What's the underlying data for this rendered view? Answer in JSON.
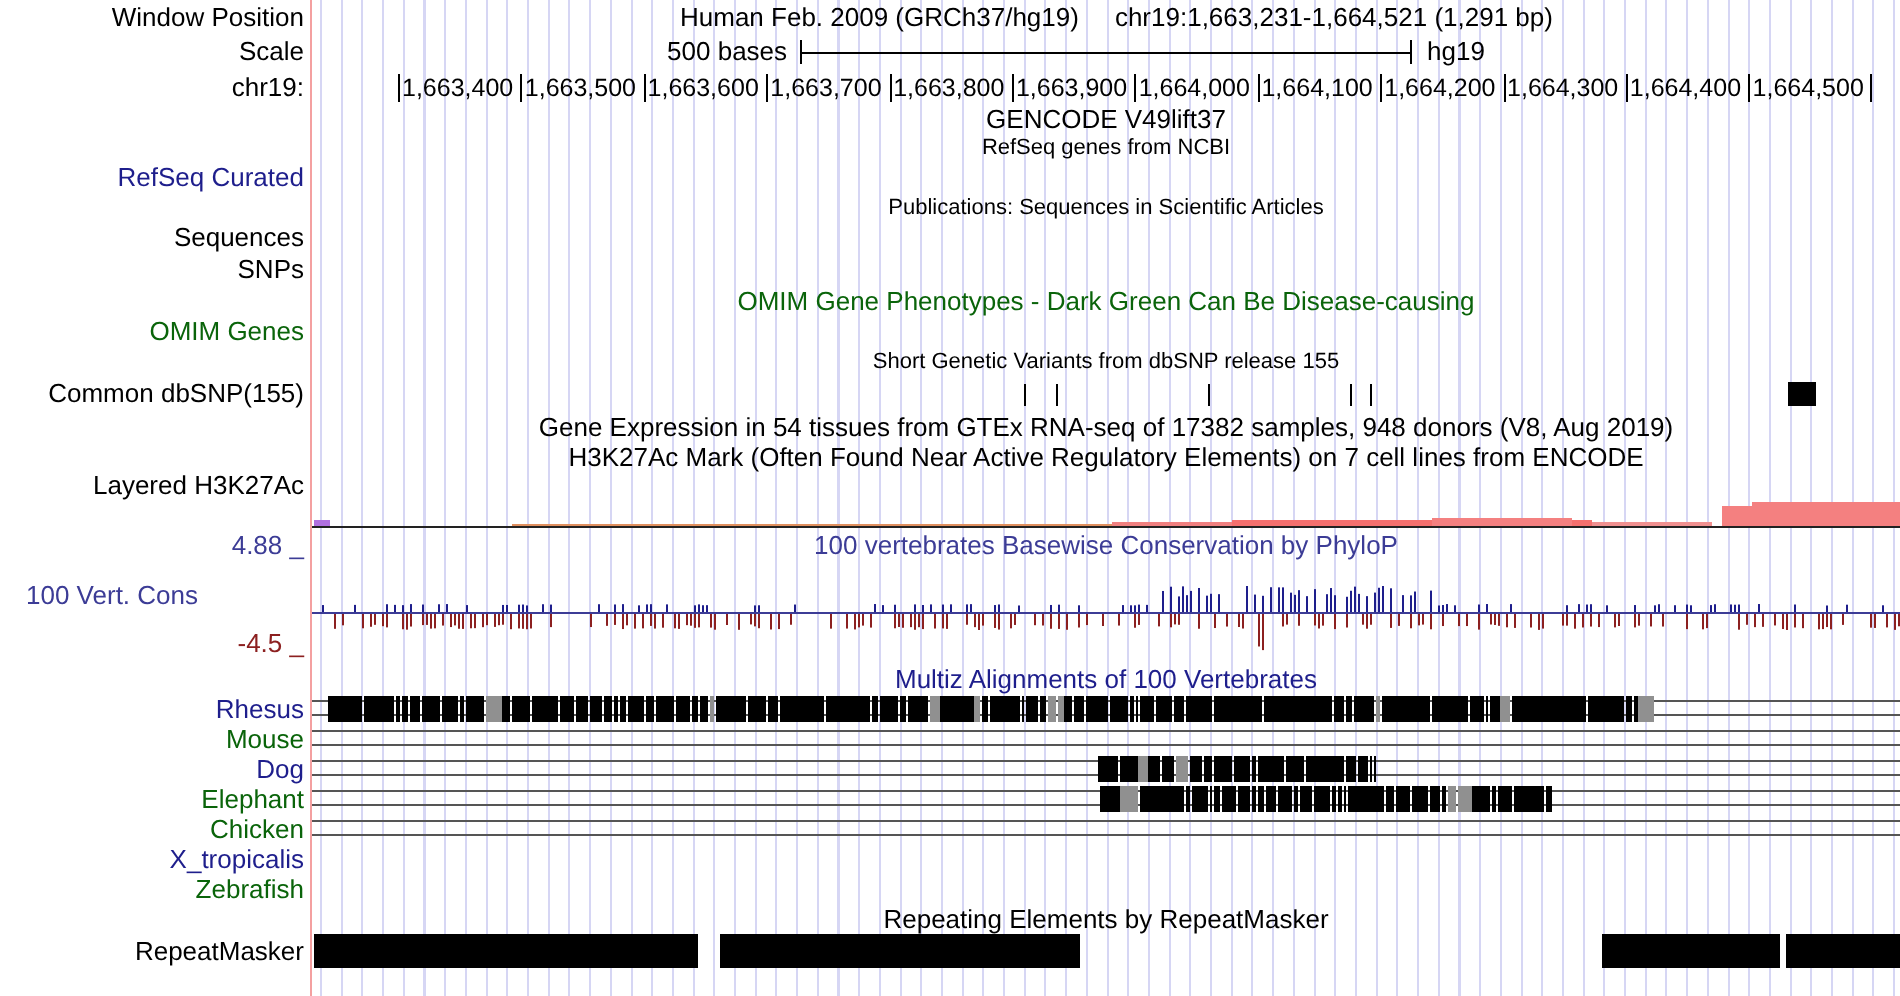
{
  "header": {
    "position_label": "Window Position",
    "assembly": "Human Feb. 2009 (GRCh37/hg19)",
    "position": "chr19:1,663,231-1,664,521 (1,291 bp)",
    "scale_label": "Scale",
    "scale_length": "500 bases",
    "scale_db": "hg19",
    "chrom_label": "chr19:",
    "ruler": [
      "1,663,400",
      "1,663,500",
      "1,663,600",
      "1,663,700",
      "1,663,800",
      "1,663,900",
      "1,664,000",
      "1,664,100",
      "1,664,200",
      "1,664,300",
      "1,664,400",
      "1,664,500"
    ]
  },
  "tracks": [
    {
      "kind": "title",
      "title": "GENCODE V49lift37"
    },
    {
      "kind": "note",
      "title": "RefSeq genes from NCBI"
    },
    {
      "kind": "label",
      "label": "RefSeq Curated",
      "color": "#1e1e8c"
    },
    {
      "kind": "note",
      "title": "Publications: Sequences in Scientific Articles"
    },
    {
      "kind": "label",
      "label": "Sequences"
    },
    {
      "kind": "label",
      "label": "SNPs"
    },
    {
      "kind": "title",
      "title": "OMIM Gene Phenotypes - Dark Green Can Be Disease-causing",
      "color": "#0a640a"
    },
    {
      "kind": "label",
      "label": "OMIM Genes",
      "color": "#0a640a"
    },
    {
      "kind": "note",
      "title": "Short Genetic Variants from dbSNP release 155"
    },
    {
      "kind": "snps",
      "label": "Common dbSNP(155)"
    },
    {
      "kind": "title",
      "title": "Gene Expression in 54 tissues from GTEx RNA-seq of 17382 samples, 948 donors (V8, Aug 2019)"
    },
    {
      "kind": "title",
      "title": "H3K27Ac Mark (Often Found Near Active Regulatory Elements) on 7 cell lines from ENCODE"
    },
    {
      "kind": "h3k27ac",
      "label": "Layered H3K27Ac"
    },
    {
      "kind": "conservation",
      "label": "100 Vert. Cons",
      "title": "100 vertebrates Basewise Conservation by PhyloP",
      "max": "4.88 _",
      "min": "-4.5 _",
      "color": "#3c3c96"
    },
    {
      "kind": "title",
      "title": "Multiz Alignments of 100 Vertebrates",
      "color": "#1e1e8c"
    },
    {
      "kind": "species",
      "label": "Rhesus",
      "color": "#1e1e8c"
    },
    {
      "kind": "species",
      "label": "Mouse",
      "color": "#0a640a"
    },
    {
      "kind": "species",
      "label": "Dog",
      "color": "#1e1e8c"
    },
    {
      "kind": "species",
      "label": "Elephant",
      "color": "#0a640a"
    },
    {
      "kind": "species",
      "label": "Chicken",
      "color": "#0a640a"
    },
    {
      "kind": "species",
      "label": "X_tropicalis",
      "color": "#1e1e8c"
    },
    {
      "kind": "species",
      "label": "Zebrafish",
      "color": "#0a640a"
    },
    {
      "kind": "title",
      "title": "Repeating Elements by RepeatMasker"
    },
    {
      "kind": "repeats",
      "label": "RepeatMasker"
    }
  ]
}
